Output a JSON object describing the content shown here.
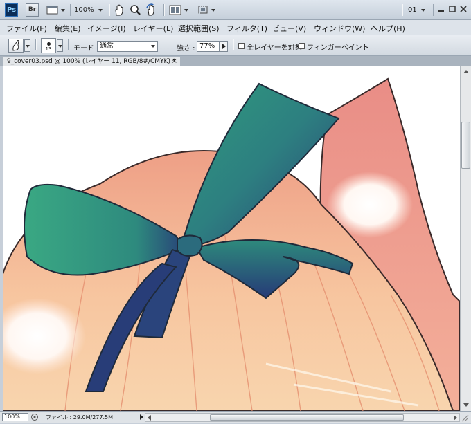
{
  "app": {
    "logo": "Ps",
    "bridge": "Br",
    "zoom": "100%",
    "workspace": "01",
    "icons": [
      "screen-mode-icon",
      "hand-tool-icon",
      "zoom-tool-icon",
      "rotate-view-icon",
      "arrange-documents-icon",
      "screen-size-icon",
      "minimize-icon",
      "restore-icon",
      "close-icon"
    ]
  },
  "menu": [
    "ファイル(F)",
    "編集(E)",
    "イメージ(I)",
    "レイヤー(L)",
    "選択範囲(S)",
    "フィルタ(T)",
    "ビュー(V)",
    "ウィンドウ(W)",
    "ヘルプ(H)"
  ],
  "options": {
    "brush_size": "13",
    "mode_label": "モード :",
    "mode_value": "通常",
    "strength_label": "強さ :",
    "strength_value": "77%",
    "sample_all_layers": "全レイヤーを対象",
    "finger_painting": "フィンガーペイント"
  },
  "document": {
    "tab_title": "9_cover03.psd @ 100% (レイヤー 11, RGB/8#/CMYK) *",
    "tab_close": "×"
  },
  "status": {
    "zoom": "100%",
    "file_info": "ファイル : 29.0M/277.5M"
  },
  "colors": {
    "ribbon_teal": "#2f8f78",
    "ribbon_navy": "#283e78",
    "hair_peach": "#f3b89a",
    "ear_pink": "#ec9a8f"
  }
}
